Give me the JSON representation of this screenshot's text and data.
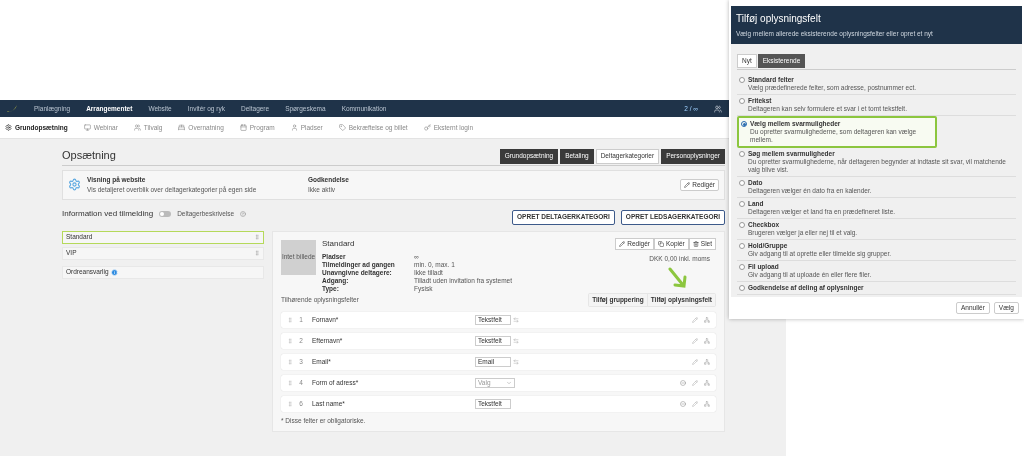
{
  "nav": {
    "items": [
      {
        "label": "Planlægning",
        "selected": false
      },
      {
        "label": "Arrangementet",
        "selected": true
      },
      {
        "label": "Website",
        "selected": false
      },
      {
        "label": "Invitér og ryk",
        "selected": false
      },
      {
        "label": "Deltagere",
        "selected": false
      },
      {
        "label": "Spørgeskema",
        "selected": false
      },
      {
        "label": "Kommunikation",
        "selected": false
      }
    ],
    "counter": "2 / ∞"
  },
  "subnav": [
    {
      "label": "Grundopsætning",
      "selected": true
    },
    {
      "label": "Webinar",
      "selected": false
    },
    {
      "label": "Tilvalg",
      "selected": false
    },
    {
      "label": "Overnatning",
      "selected": false
    },
    {
      "label": "Program",
      "selected": false
    },
    {
      "label": "Pladser",
      "selected": false
    },
    {
      "label": "Bekræftelse og billet",
      "selected": false
    },
    {
      "label": "Eksternt login",
      "selected": false
    }
  ],
  "page": {
    "title": "Opsætning",
    "tabs": [
      {
        "label": "Grundopsætning",
        "selected": false
      },
      {
        "label": "Betaling",
        "selected": false
      },
      {
        "label": "Deltagerkategorier",
        "selected": true
      },
      {
        "label": "Personoplysninger",
        "selected": false
      }
    ]
  },
  "website_box": {
    "title": "Visning på website",
    "description": "Vis detaljeret overblik over deltagerkategorier på egen side",
    "approval_label": "Godkendelse",
    "approval_value": "Ikke aktiv",
    "edit_button": "Redigér"
  },
  "info": {
    "title": "Information ved tilmelding",
    "toggle": {
      "label": "Deltagerbeskrivelse",
      "on": false
    },
    "buttons": [
      "OPRET DELTAGERKATEGORI",
      "OPRET LEDSAGERKATEGORI"
    ]
  },
  "categories": [
    {
      "label": "Standard",
      "selected": true
    },
    {
      "label": "VIP",
      "selected": false
    }
  ],
  "order_responsible": "Ordreansvarlig",
  "category_card": {
    "image_placeholder": "Intet billede",
    "title": "Standard",
    "actions": [
      "Redigér",
      "Kopiér",
      "Slet"
    ],
    "price": "DKK 0,00 inkl. moms",
    "details": [
      {
        "label": "Pladser",
        "value": "∞"
      },
      {
        "label": "Tilmeldinger ad gangen",
        "value": "min. 0, max. 1"
      },
      {
        "label": "Unavngivne deltagere:",
        "value": "Ikke tilladt"
      },
      {
        "label": "Adgang:",
        "value": "Tilladt uden invitation fra systemet"
      },
      {
        "label": "Type:",
        "value": "Fysisk"
      }
    ],
    "fields_title": "Tilhørende oplysningsfelter",
    "add_buttons": [
      "Tilføj gruppering",
      "Tilføj oplysningsfelt"
    ],
    "fields": [
      {
        "number": "1",
        "label": "Fornavn*",
        "kind": "text",
        "value": "Tekstfelt",
        "swappable": true,
        "removable": false
      },
      {
        "number": "2",
        "label": "Efternavn*",
        "kind": "text",
        "value": "Tekstfelt",
        "swappable": true,
        "removable": false
      },
      {
        "number": "3",
        "label": "Email*",
        "kind": "text",
        "value": "Email",
        "swappable": true,
        "removable": false
      },
      {
        "number": "4",
        "label": "Form of adress*",
        "kind": "select",
        "placeholder": "Valg",
        "swappable": false,
        "removable": true
      },
      {
        "number": "6",
        "label": "Last name*",
        "kind": "text",
        "value": "Tekstfelt",
        "swappable": false,
        "removable": true
      }
    ],
    "footnote": "* Disse felter er obligatoriske."
  },
  "dialog": {
    "title": "Tilføj oplysningsfelt",
    "subtitle": "Vælg mellem allerede eksisterende oplysningsfelter eller opret et nyt",
    "tabs": [
      {
        "label": "Nyt",
        "selected": true
      },
      {
        "label": "Eksisterende",
        "selected": false
      }
    ],
    "options": [
      {
        "title": "Standard felter",
        "description": "Vælg prædefinerede felter, som adresse, postnummer ect.",
        "selected": false
      },
      {
        "title": "Fritekst",
        "description": "Deltageren kan selv formulere et svar i et tomt tekstfelt.",
        "selected": false
      },
      {
        "title": "Vælg mellem svarmuligheder",
        "description": "Du opretter svarmulighederne, som deltageren kan vælge mellem.",
        "selected": true
      },
      {
        "title": "Søg mellem svarmuligheder",
        "description": "Du opretter svarmulighederne, når deltageren begynder at indtaste sit svar, vil matchende valg blive vist.",
        "selected": false
      },
      {
        "title": "Dato",
        "description": "Deltageren vælger én dato fra en kalender.",
        "selected": false
      },
      {
        "title": "Land",
        "description": "Deltageren vælger et land fra en prædefineret liste.",
        "selected": false
      },
      {
        "title": "Checkbox",
        "description": "Brugeren vælger ja eller nej til et valg.",
        "selected": false
      },
      {
        "title": "Hold/Gruppe",
        "description": "Giv adgang til at oprette eller tilmelde sig grupper.",
        "selected": false
      },
      {
        "title": "Fil upload",
        "description": "Giv adgang til at uploade én eller flere filer.",
        "selected": false
      },
      {
        "title": "Godkendelse af deling af oplysninger",
        "selected": false
      }
    ],
    "buttons": [
      "Annullér",
      "Vælg"
    ]
  }
}
